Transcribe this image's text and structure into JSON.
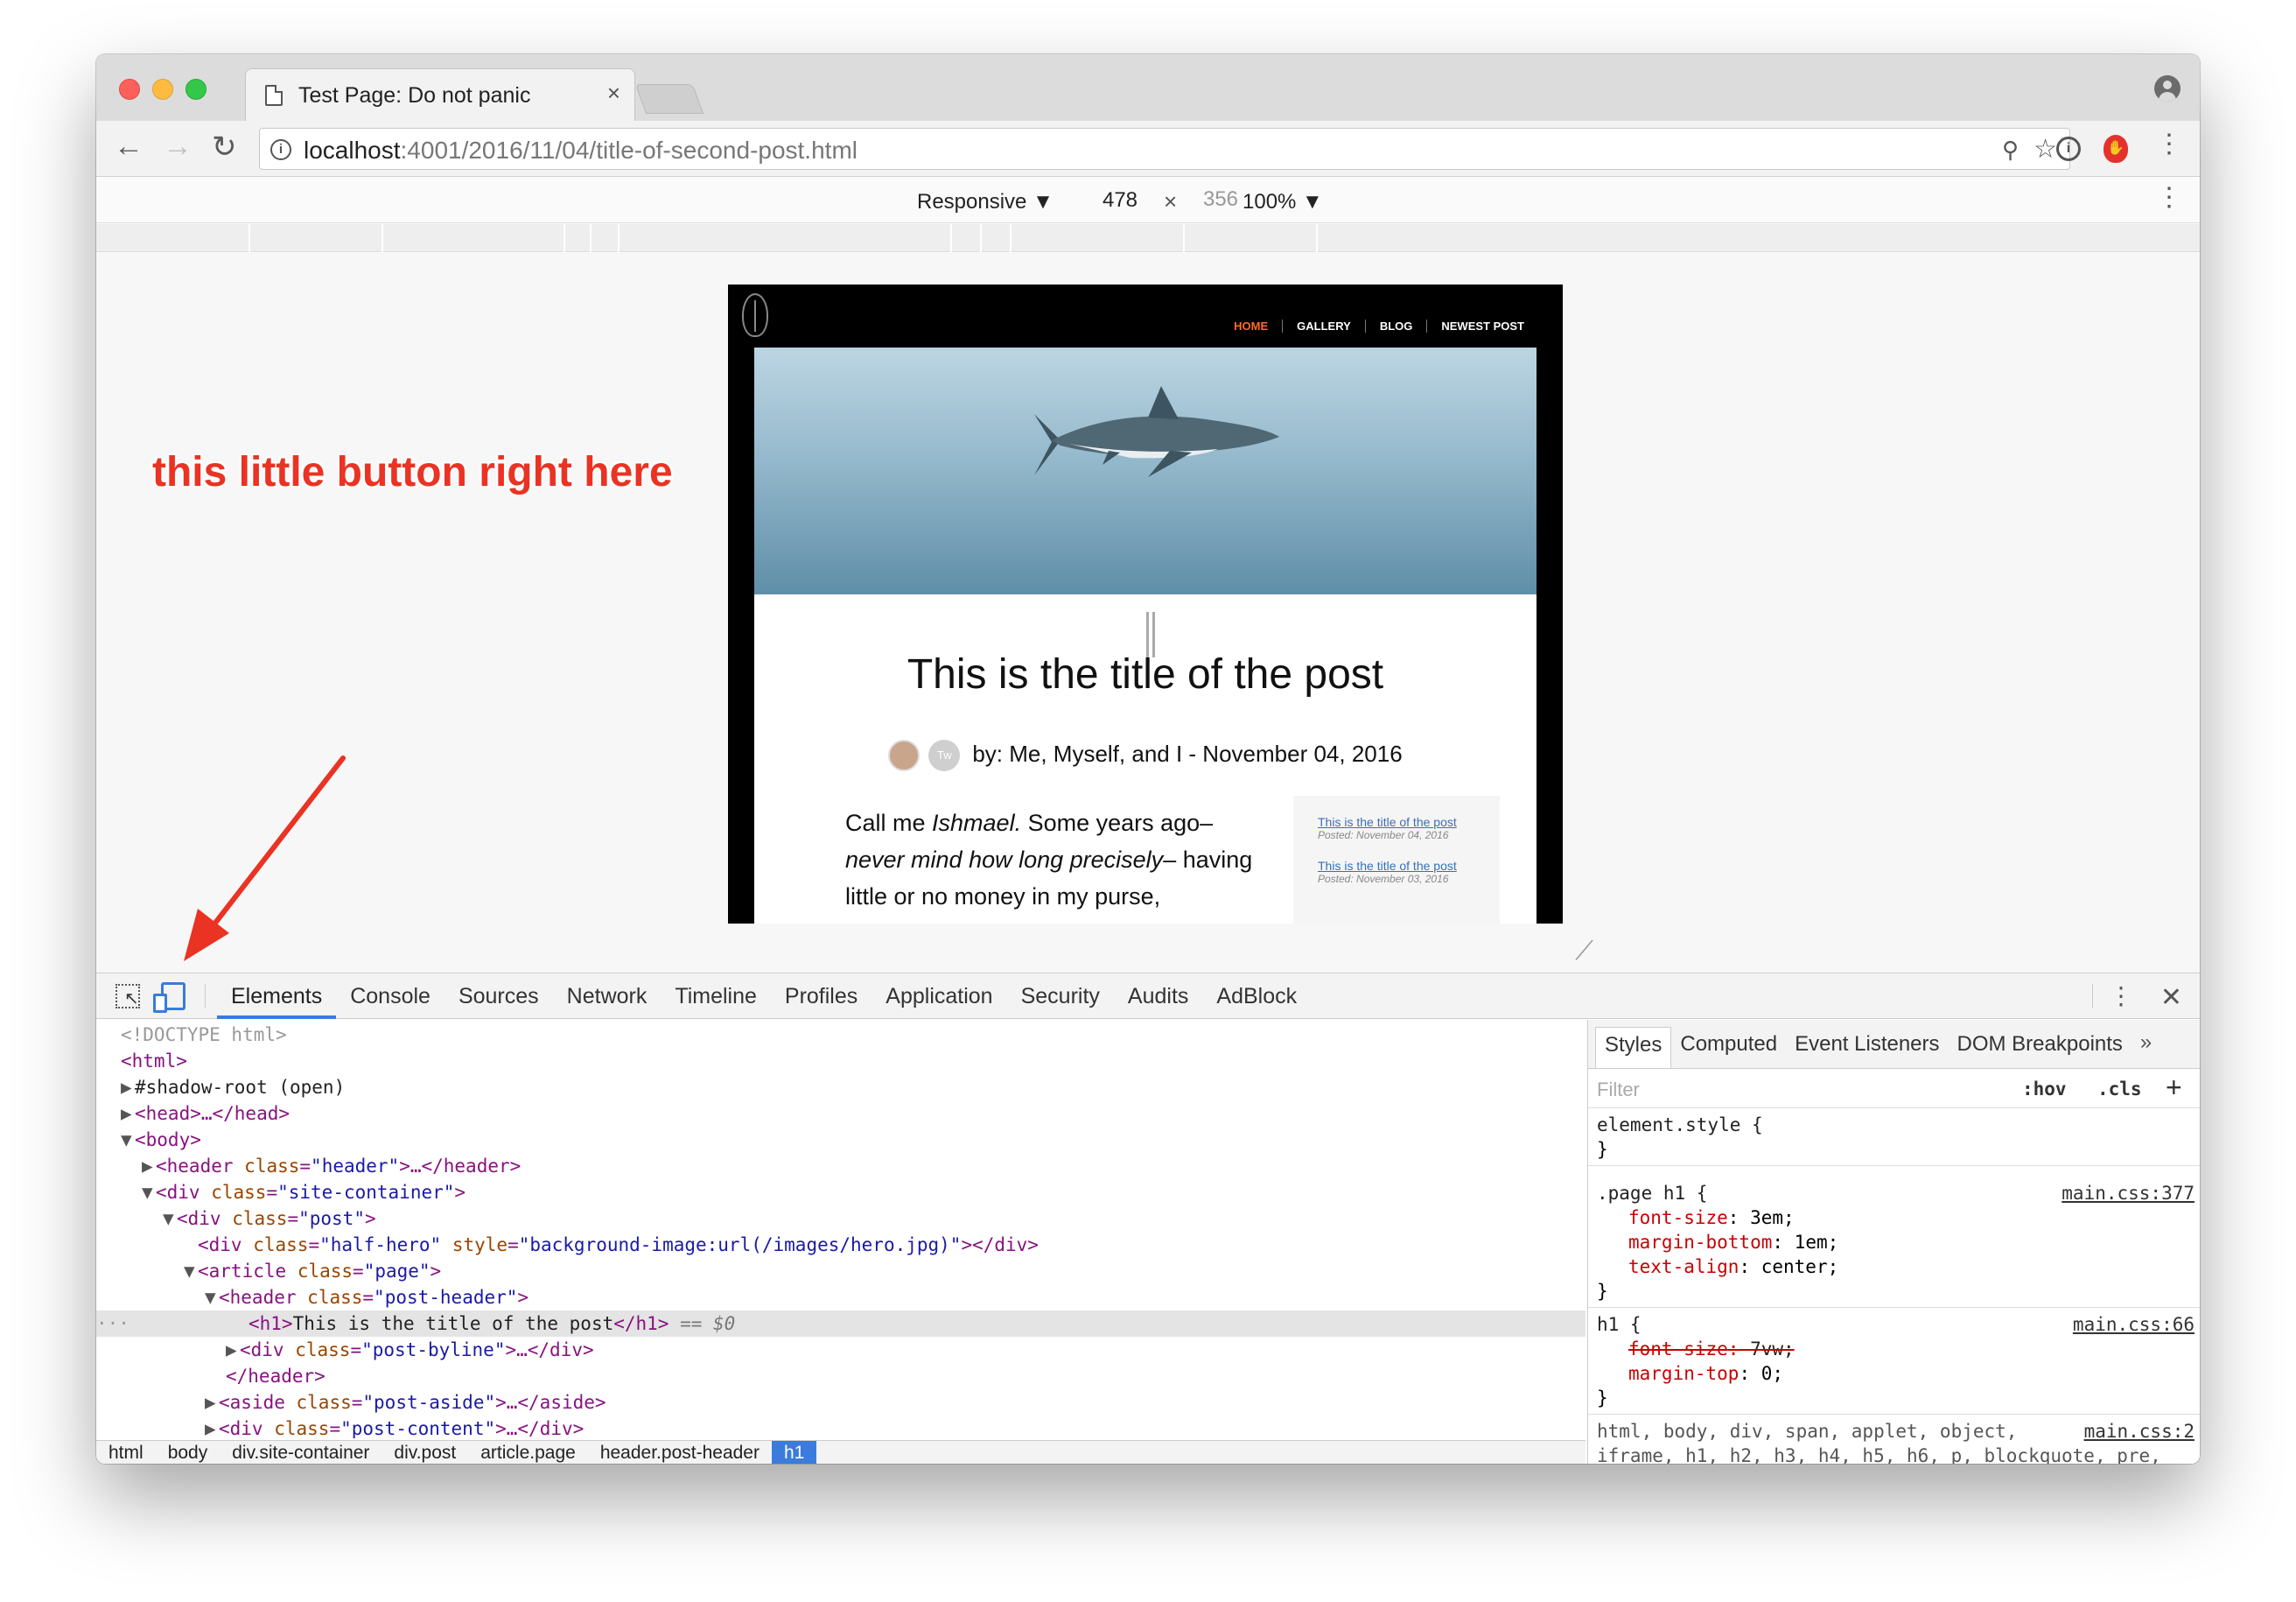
{
  "browser": {
    "tab_title": "Test Page: Do not panic",
    "tab_close": "×",
    "url_host": "localhost",
    "url_path": ":4001/2016/11/04/title-of-second-post.html"
  },
  "device_toolbar": {
    "mode": "Responsive ▼",
    "width": "478",
    "x": "×",
    "height": "356",
    "zoom": "100% ▼"
  },
  "site": {
    "nav": [
      "HOME",
      "GALLERY",
      "BLOG",
      "NEWEST POST"
    ],
    "title": "This is the title of the post",
    "byline": "by: Me, Myself, and I - November 04, 2016",
    "twitter_badge": "Tw",
    "body_1": "Call me ",
    "body_italic": "Ishmael.",
    "body_2": " Some years ago–",
    "body_italic_2": "never mind how long precisely",
    "body_3": "– having little or no money in my purse,",
    "aside": [
      {
        "title": "This is the title of the post",
        "date": "Posted: November 04, 2016"
      },
      {
        "title": "This is the title of the post",
        "date": "Posted: November 03, 2016"
      }
    ]
  },
  "annotation": {
    "text": "this little button right here",
    "color": "#ea3323"
  },
  "devtools": {
    "tabs": [
      "Elements",
      "Console",
      "Sources",
      "Network",
      "Timeline",
      "Profiles",
      "Application",
      "Security",
      "Audits",
      "AdBlock"
    ],
    "active_tab": "Elements",
    "dom": {
      "doctype": "<!DOCTYPE html>",
      "html_open": "<html>",
      "shadow_root": "#shadow-root (open)",
      "head": "<head>…</head>",
      "body_open": "<body>",
      "header_tag": "<header",
      "header_class_attr": "class",
      "header_class_val": "\"header\"",
      "header_rest": ">…</header>",
      "div_tag": "<div",
      "div_class_attr": "class",
      "site_container_val": "\"site-container\"",
      "post_val": "\"post\"",
      "half_hero_val": "\"half-hero\"",
      "style_attr": "style",
      "style_val": "\"background-image:url(/images/hero.jpg)\"",
      "article_tag": "<article",
      "page_val": "\"page\"",
      "post_header_val": "\"post-header\"",
      "h1_text": "This is the title of the post",
      "eq0": "== $0",
      "post_byline_val": "\"post-byline\"",
      "header_close": "</header>",
      "aside_tag": "<aside",
      "post_aside_val": "\"post-aside\"",
      "aside_rest": ">…</aside>",
      "post_content_val": "\"post-content\"",
      "div_rest": ">…</div>"
    },
    "breadcrumbs": [
      "html",
      "body",
      "div.site-container",
      "div.post",
      "article.page",
      "header.post-header",
      "h1"
    ],
    "styles": {
      "tabs": [
        "Styles",
        "Computed",
        "Event Listeners",
        "DOM Breakpoints"
      ],
      "filter_placeholder": "Filter",
      "hov": ":hov",
      "cls": ".cls",
      "plus": "+",
      "element_style": "element.style {",
      "close_brace": "}",
      "rule1_selector": ".page h1 {",
      "rule1_source": "main.css:377",
      "rule1_decls": [
        {
          "prop": "font-size",
          "val": "3em;"
        },
        {
          "prop": "margin-bottom",
          "val": "1em;"
        },
        {
          "prop": "text-align",
          "val": "center;"
        }
      ],
      "rule2_selector": "h1 {",
      "rule2_source": "main.css:66",
      "rule2_decl1_prop": "font-size",
      "rule2_decl1_val": "7vw;",
      "rule2_decl2_prop": "margin-top",
      "rule2_decl2_val": "0;",
      "rule3_line1": "html, body, div, span, applet, object,",
      "rule3_line2": "iframe, h1, h2, h3, h4, h5, h6, p, blockquote, pre,",
      "rule3_source": "main.css:2"
    }
  }
}
